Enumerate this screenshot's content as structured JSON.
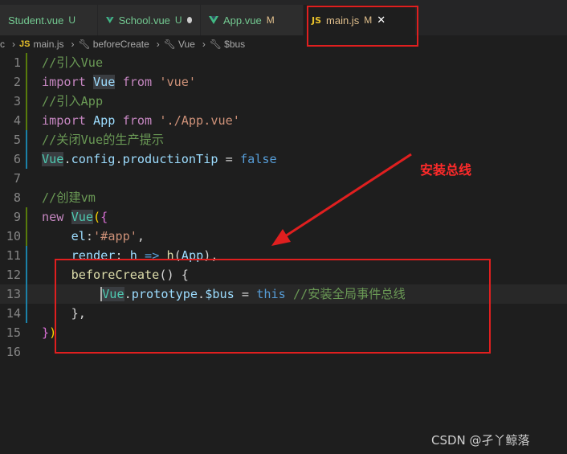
{
  "tabs": [
    {
      "name": "Student.vue",
      "status": "U",
      "icon": "vue-icon"
    },
    {
      "name": "School.vue",
      "status": "U",
      "icon": "vue-icon",
      "unsaved": true
    },
    {
      "name": "App.vue",
      "status": "M",
      "icon": "vue-icon"
    },
    {
      "name": "main.js",
      "status": "M",
      "icon": "js-icon",
      "active": true
    }
  ],
  "tab_js_label": "JS",
  "tab_close": "✕",
  "breadcrumb": {
    "folder": "c",
    "file": "main.js",
    "items": [
      "beforeCreate",
      "Vue",
      "$bus"
    ]
  },
  "code_lines": [
    {
      "n": "1",
      "tokens": [
        [
          "c",
          "//引入Vue"
        ]
      ]
    },
    {
      "n": "2",
      "tokens": [
        [
          "k",
          "import "
        ],
        [
          "v sel",
          "Vue"
        ],
        [
          "k",
          " from "
        ],
        [
          "s",
          "'vue'"
        ]
      ]
    },
    {
      "n": "3",
      "tokens": [
        [
          "c",
          "//引入App"
        ]
      ]
    },
    {
      "n": "4",
      "tokens": [
        [
          "k",
          "import "
        ],
        [
          "v",
          "App"
        ],
        [
          "k",
          " from "
        ],
        [
          "s",
          "'./App.vue'"
        ]
      ]
    },
    {
      "n": "5",
      "tokens": [
        [
          "c",
          "//关闭Vue的生产提示"
        ]
      ]
    },
    {
      "n": "6",
      "tokens": [
        [
          "cls sel",
          "Vue"
        ],
        [
          "p",
          "."
        ],
        [
          "v",
          "config"
        ],
        [
          "p",
          "."
        ],
        [
          "v",
          "productionTip"
        ],
        [
          "p",
          " = "
        ],
        [
          "b",
          "false"
        ]
      ]
    },
    {
      "n": "7",
      "tokens": []
    },
    {
      "n": "8",
      "tokens": [
        [
          "c",
          "//创建vm"
        ]
      ]
    },
    {
      "n": "9",
      "tokens": [
        [
          "k",
          "new "
        ],
        [
          "cls sel",
          "Vue"
        ],
        [
          "y",
          "("
        ],
        [
          "pk",
          "{"
        ]
      ]
    },
    {
      "n": "10",
      "tokens": [
        [
          "p",
          "    "
        ],
        [
          "v",
          "el"
        ],
        [
          "p",
          ":"
        ],
        [
          "s",
          "'#app'"
        ],
        [
          "p",
          ","
        ]
      ]
    },
    {
      "n": "11",
      "tokens": [
        [
          "p",
          "    "
        ],
        [
          "v",
          "render"
        ],
        [
          "p",
          ": "
        ],
        [
          "v",
          "h"
        ],
        [
          "b",
          " => "
        ],
        [
          "fn",
          "h"
        ],
        [
          "p",
          "("
        ],
        [
          "v",
          "App"
        ],
        [
          "p",
          "),"
        ]
      ]
    },
    {
      "n": "12",
      "tokens": [
        [
          "p",
          "    "
        ],
        [
          "fn",
          "beforeCreate"
        ],
        [
          "p",
          "() "
        ],
        [
          "p",
          "{"
        ]
      ]
    },
    {
      "n": "13",
      "tokens": [
        [
          "p",
          "        "
        ],
        [
          "cls sel cursor",
          "Vue"
        ],
        [
          "p",
          "."
        ],
        [
          "v",
          "prototype"
        ],
        [
          "p",
          "."
        ],
        [
          "v",
          "$bus"
        ],
        [
          "p",
          " = "
        ],
        [
          "b",
          "this"
        ],
        [
          "c",
          " //安装全局事件总线"
        ]
      ]
    },
    {
      "n": "14",
      "tokens": [
        [
          "p",
          "    "
        ],
        [
          "p",
          "},"
        ]
      ]
    },
    {
      "n": "15",
      "tokens": [
        [
          "pk",
          "}"
        ],
        [
          "y",
          ")"
        ]
      ]
    },
    {
      "n": "16",
      "tokens": []
    }
  ],
  "annotation": "安装总线",
  "watermark": "CSDN @孑丫鲸落",
  "colors": {
    "highlight_box": "#e01f1f",
    "annotation": "#ff2a2a"
  }
}
